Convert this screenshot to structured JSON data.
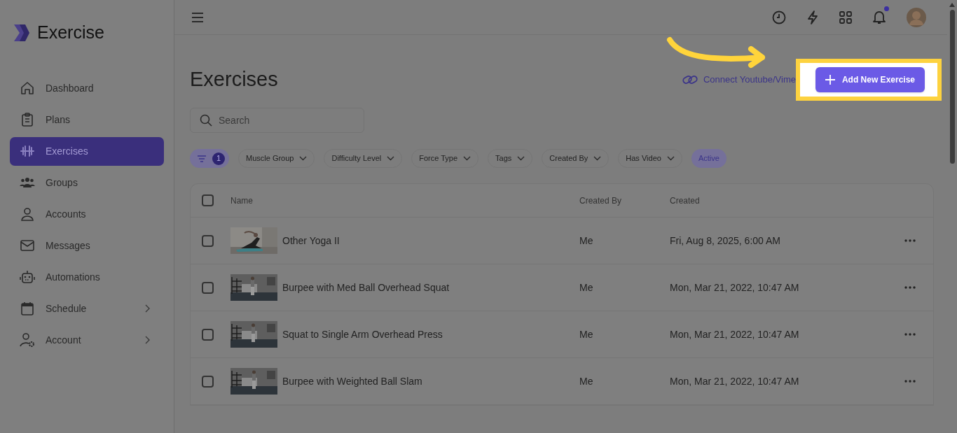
{
  "brand": {
    "name": "Exercise"
  },
  "sidebar": {
    "items": [
      {
        "label": "Dashboard",
        "selected": false,
        "expandable": false
      },
      {
        "label": "Plans",
        "selected": false,
        "expandable": false
      },
      {
        "label": "Exercises",
        "selected": true,
        "expandable": false
      },
      {
        "label": "Groups",
        "selected": false,
        "expandable": false
      },
      {
        "label": "Accounts",
        "selected": false,
        "expandable": false
      },
      {
        "label": "Messages",
        "selected": false,
        "expandable": false
      },
      {
        "label": "Automations",
        "selected": false,
        "expandable": false
      },
      {
        "label": "Schedule",
        "selected": false,
        "expandable": true
      },
      {
        "label": "Account",
        "selected": false,
        "expandable": true
      }
    ]
  },
  "header": {
    "notification_dot": true
  },
  "page": {
    "title": "Exercises",
    "link": "Connect Youtube/Vime",
    "primary_button": "Add New Exercise",
    "highlighted": true
  },
  "search": {
    "placeholder": "Search"
  },
  "filter_count": "1",
  "filters": [
    {
      "label": "Muscle Group",
      "kind": "dropdown"
    },
    {
      "label": "Difficulty Level",
      "kind": "dropdown"
    },
    {
      "label": "Force Type",
      "kind": "dropdown"
    },
    {
      "label": "Tags",
      "kind": "dropdown"
    },
    {
      "label": "Created By",
      "kind": "dropdown"
    },
    {
      "label": "Has Video",
      "kind": "dropdown"
    },
    {
      "label": "Active",
      "kind": "toggle"
    }
  ],
  "table": {
    "all_checked": false,
    "columns": [
      "Name",
      "Created By",
      "Created"
    ],
    "rows": [
      {
        "name": "Other Yoga II",
        "created_by": "Me",
        "created": "Fri, Aug 8, 2025, 6:00 AM",
        "checked": false
      },
      {
        "name": "Burpee with Med Ball Overhead Squat",
        "created_by": "Me",
        "created": "Mon, Mar 21, 2022, 10:47 AM",
        "checked": false
      },
      {
        "name": "Squat to Single Arm Overhead Press",
        "created_by": "Me",
        "created": "Mon, Mar 21, 2022, 10:47 AM",
        "checked": false
      },
      {
        "name": "Burpee with Weighted Ball Slam",
        "created_by": "Me",
        "created": "Mon, Mar 21, 2022, 10:47 AM",
        "checked": false
      }
    ]
  }
}
